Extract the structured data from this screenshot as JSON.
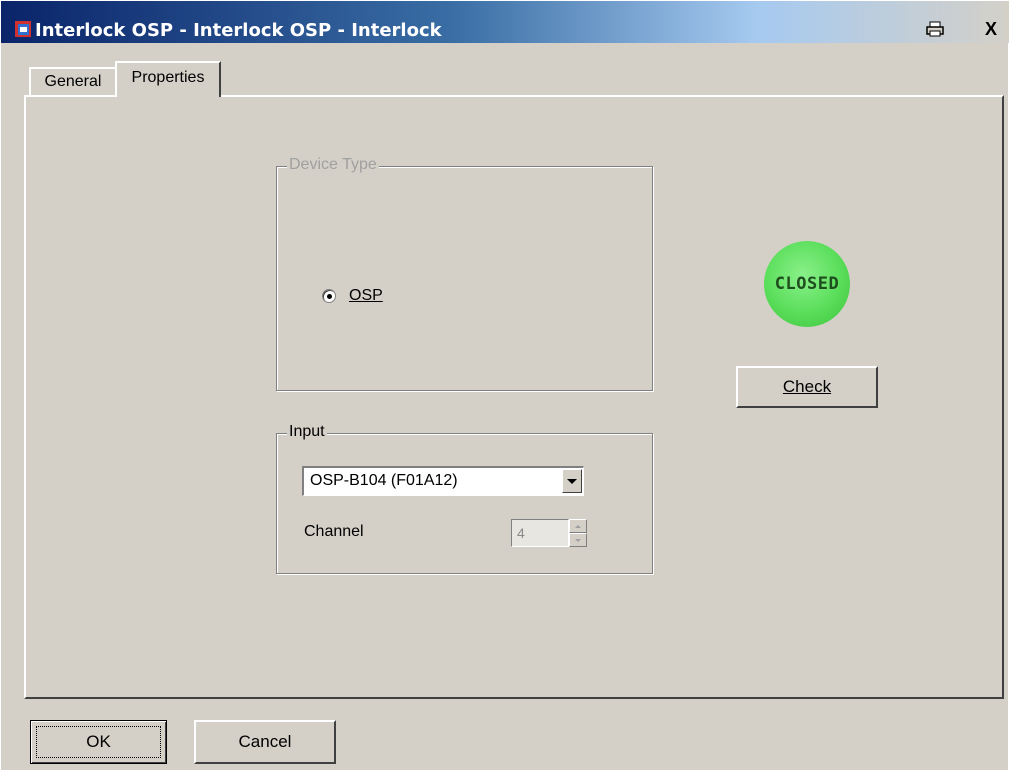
{
  "window": {
    "title": "Interlock OSP - Interlock OSP - Interlock",
    "print_icon": "printer-icon",
    "close_label": "X"
  },
  "tabs": [
    {
      "label": "General",
      "selected": false
    },
    {
      "label": "Properties",
      "selected": true
    }
  ],
  "device_type": {
    "legend": "Device Type",
    "enabled": false,
    "options": [
      {
        "label": "OSP",
        "checked": true
      }
    ]
  },
  "input": {
    "legend": "Input",
    "selected": "OSP-B104 (F01A12)",
    "channel_label": "Channel",
    "channel_value": "4"
  },
  "status": {
    "text": "CLOSED",
    "color": "#5ade5a"
  },
  "buttons": {
    "check": "Check",
    "ok": "OK",
    "cancel": "Cancel"
  }
}
